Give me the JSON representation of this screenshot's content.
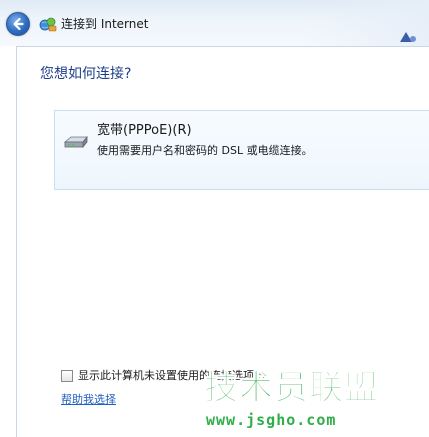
{
  "window": {
    "title": "连接到 Internet"
  },
  "main": {
    "heading": "您想如何连接?",
    "options": [
      {
        "title": "宽带(PPPoE)(R)",
        "description": "使用需要用户名和密码的 DSL 或电缆连接。",
        "icon": "modem-icon"
      }
    ],
    "show_unconfigured_checkbox_label": "显示此计算机未设置使用的连接选项(S",
    "show_unconfigured_checked": false,
    "help_link": "帮助我选择"
  },
  "watermark": {
    "title": "技术员联盟",
    "url": "www.jsgho.com"
  },
  "colors": {
    "heading": "#1e3f8a",
    "link": "#1f5fbf",
    "card_border": "#c6dff3",
    "watermark": "#2fae4a"
  }
}
